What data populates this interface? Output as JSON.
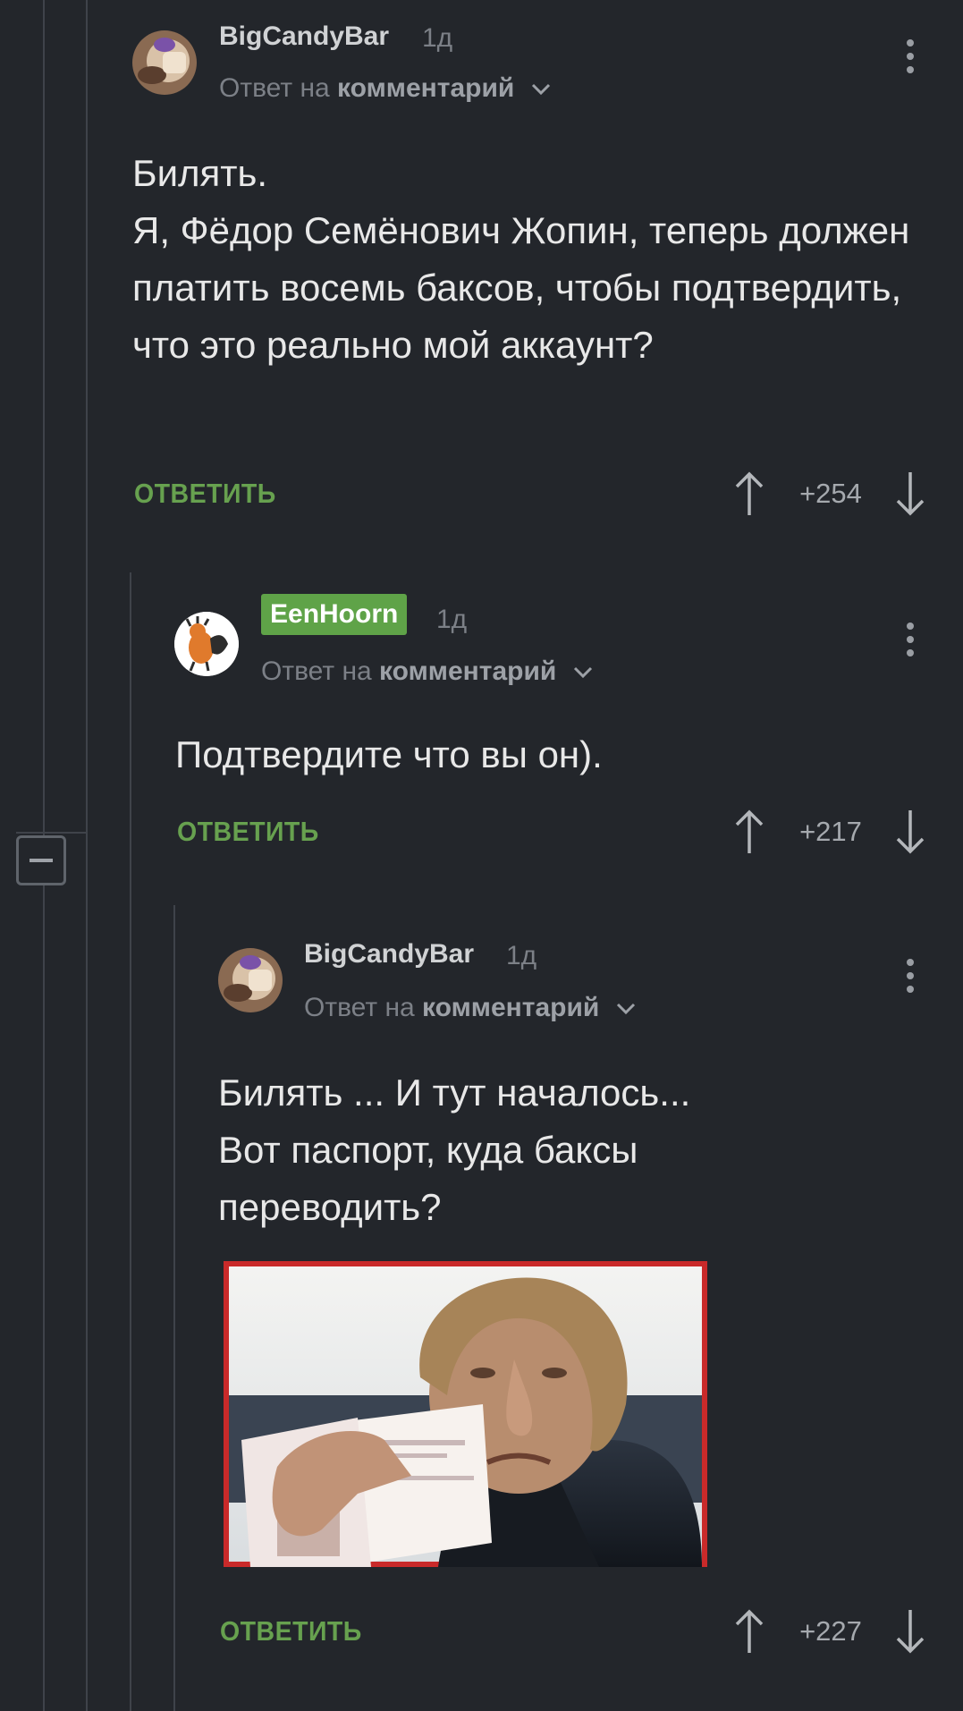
{
  "comments": [
    {
      "username": "BigCandyBar",
      "time": "1д",
      "reply_prefix": "Ответ на",
      "reply_target": "комментарий",
      "text": "Билять.\nЯ, Фёдор Семёнович Жопин, теперь должен платить восемь баксов, чтобы подтвердить, что это реально мой аккаунт?",
      "reply_label": "ОТВЕТИТЬ",
      "score": "+254",
      "avatar_icon": "candy-avatar-icon"
    },
    {
      "username": "EenHoorn",
      "time": "1д",
      "reply_prefix": "Ответ на",
      "reply_target": "комментарий",
      "text": "Подтвердите что вы он).",
      "reply_label": "ОТВЕТИТЬ",
      "score": "+217",
      "avatar_icon": "horse-cartoon-avatar-icon",
      "badge_color": "#5fa348"
    },
    {
      "username": "BigCandyBar",
      "time": "1д",
      "reply_prefix": "Ответ на",
      "reply_target": "комментарий",
      "text": "Билять ... И тут началось...\nВот паспорт, куда баксы переводить?",
      "reply_label": "ОТВЕТИТЬ",
      "score": "+227",
      "avatar_icon": "candy-avatar-icon",
      "image": "man-holding-passport-photo"
    }
  ],
  "colors": {
    "background": "#23262b",
    "accent_green": "#67a14f",
    "muted_text": "#7c8087"
  }
}
